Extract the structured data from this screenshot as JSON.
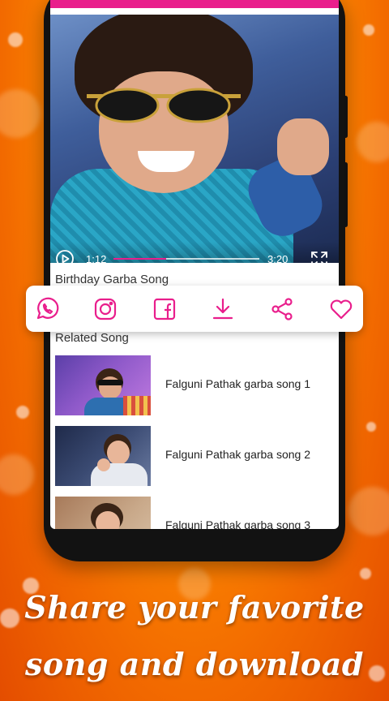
{
  "player": {
    "current_time": "1:12",
    "total_time": "3:20",
    "progress": 0.36,
    "accent_color": "#e91e8c"
  },
  "song": {
    "title": "Birthday Garba Song"
  },
  "share_bar": {
    "icons": [
      "whatsapp-icon",
      "instagram-icon",
      "facebook-icon",
      "download-icon",
      "share-icon",
      "heart-icon"
    ],
    "icon_color": "#e91e8c"
  },
  "related": {
    "title": "Related Song",
    "items": [
      {
        "label": "Falguni Pathak garba song 1"
      },
      {
        "label": "Falguni Pathak garba song 2"
      },
      {
        "label": "Falguni Pathak garba song 3"
      }
    ]
  },
  "caption": {
    "line1": "Share your favorite",
    "line2": "song and download"
  }
}
